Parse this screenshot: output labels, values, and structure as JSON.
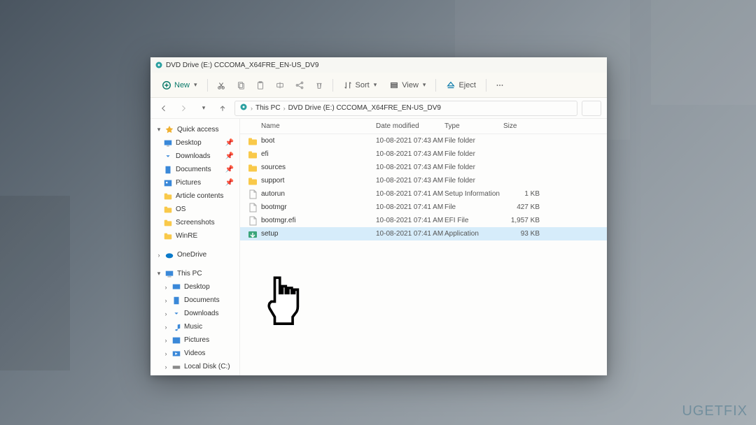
{
  "window": {
    "title": "DVD Drive (E:) CCCOMA_X64FRE_EN-US_DV9"
  },
  "toolbar": {
    "new": "New",
    "sort": "Sort",
    "view": "View",
    "eject": "Eject"
  },
  "breadcrumb": {
    "thispc": "This PC",
    "drive": "DVD Drive (E:) CCCOMA_X64FRE_EN-US_DV9"
  },
  "sidebar": {
    "quickaccess": "Quick access",
    "desktop": "Desktop",
    "downloads": "Downloads",
    "documents": "Documents",
    "pictures": "Pictures",
    "article": "Article contents",
    "os": "OS",
    "screenshots": "Screenshots",
    "winre": "WinRE",
    "onedrive": "OneDrive",
    "thispc": "This PC",
    "tp_desktop": "Desktop",
    "tp_documents": "Documents",
    "tp_downloads": "Downloads",
    "tp_music": "Music",
    "tp_pictures": "Pictures",
    "tp_videos": "Videos",
    "tp_localdisk": "Local Disk (C:)"
  },
  "columns": {
    "name": "Name",
    "date": "Date modified",
    "type": "Type",
    "size": "Size"
  },
  "files": [
    {
      "name": "boot",
      "date": "10-08-2021 07:43 AM",
      "type": "File folder",
      "size": "",
      "icon": "folder"
    },
    {
      "name": "efi",
      "date": "10-08-2021 07:43 AM",
      "type": "File folder",
      "size": "",
      "icon": "folder"
    },
    {
      "name": "sources",
      "date": "10-08-2021 07:43 AM",
      "type": "File folder",
      "size": "",
      "icon": "folder"
    },
    {
      "name": "support",
      "date": "10-08-2021 07:43 AM",
      "type": "File folder",
      "size": "",
      "icon": "folder"
    },
    {
      "name": "autorun",
      "date": "10-08-2021 07:41 AM",
      "type": "Setup Information",
      "size": "1 KB",
      "icon": "file"
    },
    {
      "name": "bootmgr",
      "date": "10-08-2021 07:41 AM",
      "type": "File",
      "size": "427 KB",
      "icon": "file"
    },
    {
      "name": "bootmgr.efi",
      "date": "10-08-2021 07:41 AM",
      "type": "EFI File",
      "size": "1,957 KB",
      "icon": "file"
    },
    {
      "name": "setup",
      "date": "10-08-2021 07:41 AM",
      "type": "Application",
      "size": "93 KB",
      "icon": "setup",
      "selected": true
    }
  ],
  "watermark": "UGETFIX"
}
